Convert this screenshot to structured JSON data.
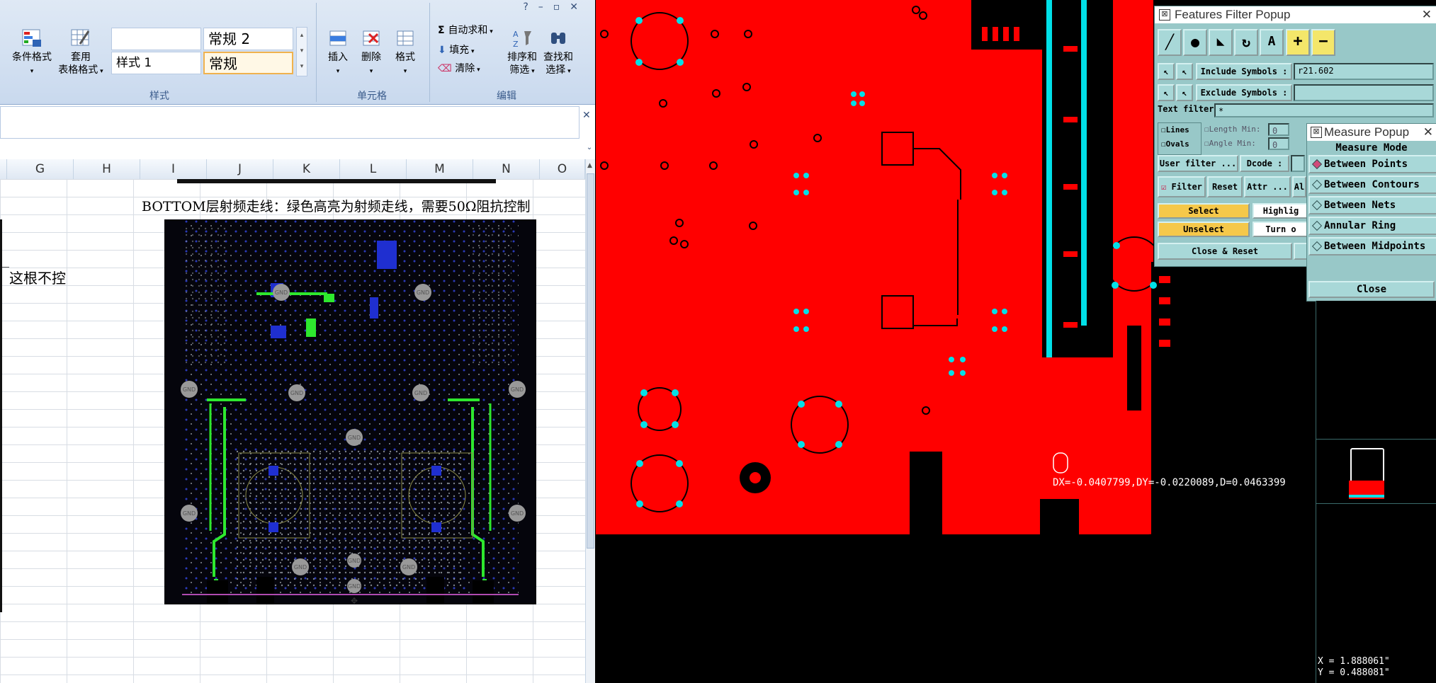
{
  "excel": {
    "ribbon": {
      "groups": {
        "styles_label": "样式",
        "cells_label": "单元格",
        "editing_label": "编辑"
      },
      "buttons": {
        "cond_format": "条件格式",
        "table_format_1": "套用",
        "table_format_2": "表格格式",
        "insert": "插入",
        "delete": "删除",
        "format": "格式",
        "autosum": "自动求和",
        "fill": "填充",
        "clear": "清除",
        "sort_filter_1": "排序和",
        "sort_filter_2": "筛选",
        "find_select_1": "查找和",
        "find_select_2": "选择"
      },
      "styles": {
        "style_blank": "",
        "style_normal2": "常规 2",
        "style1": "样式 1",
        "style_normal": "常规"
      }
    },
    "columns": [
      "G",
      "H",
      "I",
      "J",
      "K",
      "L",
      "M",
      "N",
      "O"
    ],
    "cell_note": "这根不控",
    "caption": "BOTTOM层射频走线：绿色高亮为射频走线，需要50Ω阻抗控制",
    "gnd_label": "GND"
  },
  "cam": {
    "features_filter": {
      "title": "Features Filter Popup",
      "include_symbols_label": "Include Symbols :",
      "include_symbols_value": "r21.602",
      "exclude_symbols_label": "Exclude Symbols :",
      "exclude_symbols_value": "",
      "text_filter_label": "Text filter",
      "text_filter_value": "*",
      "lines": "Lines",
      "ovals": "Ovals",
      "length": "Length",
      "angle": "Angle",
      "min": "Min:",
      "min_val": "0",
      "user_filter": "User filter ...",
      "dcode": "Dcode :",
      "filter": "Filter",
      "reset": "Reset",
      "attr": "Attr ...",
      "al": "Al",
      "select": "Select",
      "highlight": "Highlig",
      "unselect": "Unselect",
      "turn_off": "Turn o",
      "close_reset": "Close & Reset"
    },
    "measure": {
      "title": "Measure Popup",
      "mode_label": "Measure Mode",
      "items": [
        "Between Points",
        "Between Contours",
        "Between Nets",
        "Annular Ring",
        "Between Midpoints"
      ],
      "selected_index": 0,
      "close": "Close"
    },
    "readout": "DX=-0.0407799,DY=-0.0220089,D=0.0463399",
    "coord_x": "X = 1.888061\"",
    "coord_y": "Y = 0.488081\"",
    "colors": {
      "copper": "#ff0000",
      "highlight": "#00e0e8",
      "panel": "#98c8c8"
    }
  }
}
